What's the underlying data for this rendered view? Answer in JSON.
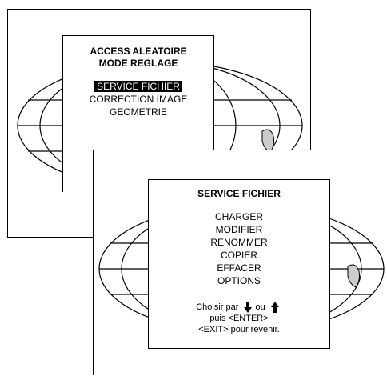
{
  "back_menu": {
    "title_line1": "ACCESS ALEATOIRE",
    "title_line2": "MODE REGLAGE",
    "items": [
      {
        "label": "SERVICE FICHIER",
        "selected": true
      },
      {
        "label": "CORRECTION IMAGE",
        "selected": false
      },
      {
        "label": "GEOMETRIE",
        "selected": false
      }
    ]
  },
  "front_menu": {
    "title": "SERVICE FICHIER",
    "items": [
      {
        "label": "CHARGER"
      },
      {
        "label": "MODIFIER"
      },
      {
        "label": "RENOMMER"
      },
      {
        "label": "COPIER"
      },
      {
        "label": "EFFACER"
      },
      {
        "label": "OPTIONS"
      }
    ],
    "help": {
      "choose_prefix": "Choisir par",
      "or_word": "ou",
      "then_enter": "puis <ENTER>",
      "exit_line": "<EXIT> pour revenir.",
      "down_icon": "arrow-down-icon",
      "up_icon": "arrow-up-icon"
    }
  }
}
